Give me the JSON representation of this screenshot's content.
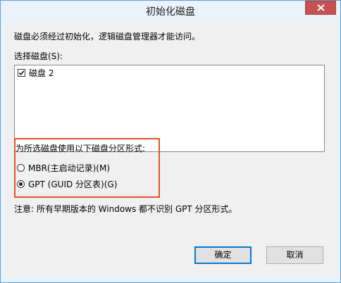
{
  "window": {
    "title": "初始化磁盘"
  },
  "dialog": {
    "intro": "磁盘必须经过初始化，逻辑磁盘管理器才能访问。",
    "select_label": "选择磁盘(S):",
    "disks": [
      {
        "label": "磁盘 2",
        "checked": true
      }
    ],
    "partition_style_label": "为所选磁盘使用以下磁盘分区形式:",
    "options": [
      {
        "label": "MBR(主启动记录)(M)",
        "selected": false
      },
      {
        "label": "GPT (GUID 分区表)(G)",
        "selected": true
      }
    ],
    "note": "注意: 所有早期版本的 Windows 都不识别 GPT 分区形式。",
    "ok_label": "确定",
    "cancel_label": "取消"
  },
  "icons": {
    "close": "close-icon",
    "check": "checkmark-icon"
  },
  "colors": {
    "highlight": "#e2512c",
    "close_button": "#c75050",
    "title_bar": "#eaf3fb",
    "client": "#f0f0f0",
    "default_button_border": "#0078d7"
  }
}
